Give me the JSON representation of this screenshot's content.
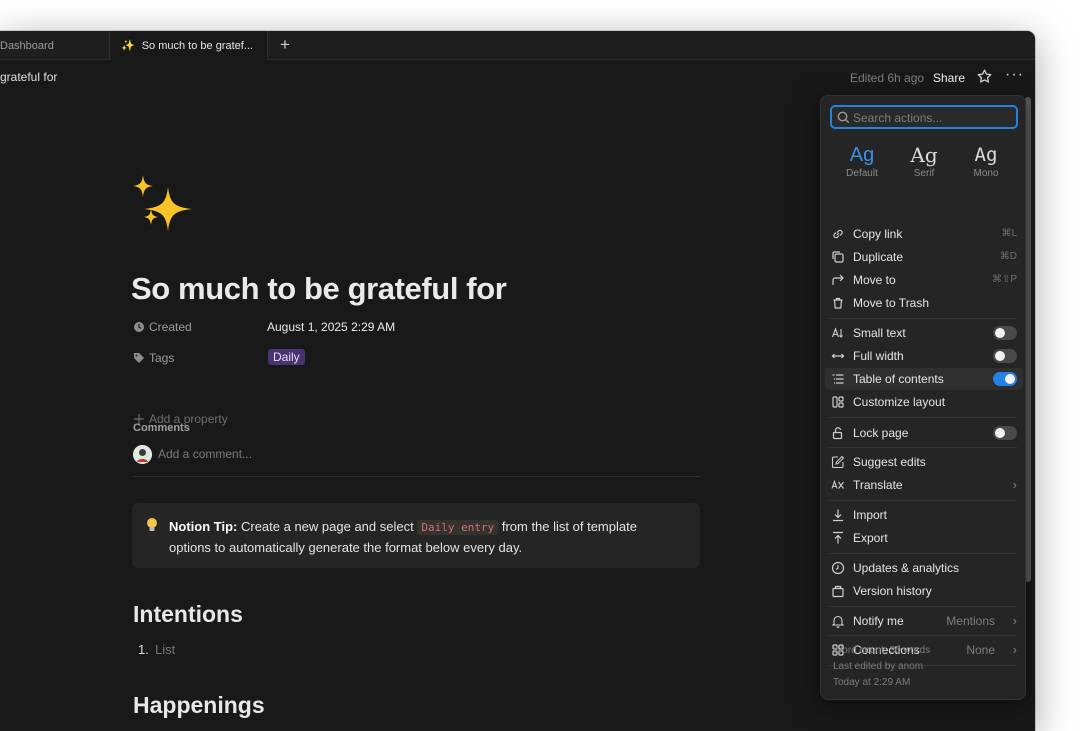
{
  "tabs": [
    {
      "label": "Dashboard"
    },
    {
      "emoji": "✨",
      "label": "So much to be gratef..."
    }
  ],
  "new_tab_icon": "plus-icon",
  "breadcrumb": "grateful for",
  "header": {
    "edited": "Edited 6h ago",
    "share": "Share",
    "favorite_icon": "star-icon",
    "more_icon": "more-icon"
  },
  "page": {
    "emoji_icon": "sparkles-icon",
    "title": "So much to be grateful for",
    "properties": {
      "created_label": "Created",
      "created_value": "August 1, 2025 2:29 AM",
      "tags_label": "Tags",
      "tag_value": "Daily",
      "add_property": "Add a property"
    },
    "comments_label": "Comments",
    "comment_placeholder": "Add a comment...",
    "callout": {
      "bold": "Notion Tip:",
      "text_before": "Create a new page and select",
      "code": "Daily entry",
      "text_after": "from the list of template options to automatically generate the format below every day."
    },
    "heading_intentions": "Intentions",
    "list_number": "1.",
    "list_placeholder": "List",
    "heading_happenings": "Happenings"
  },
  "menu": {
    "search_placeholder": "Search actions...",
    "fonts": [
      {
        "sample": "Ag",
        "label": "Default",
        "active": true
      },
      {
        "sample": "Ag",
        "label": "Serif",
        "active": false
      },
      {
        "sample": "Ag",
        "label": "Mono",
        "active": false
      }
    ],
    "items": {
      "copy_link": {
        "label": "Copy link",
        "shortcut": "⌘L"
      },
      "duplicate": {
        "label": "Duplicate",
        "shortcut": "⌘D"
      },
      "move_to": {
        "label": "Move to",
        "shortcut": "⌘⇧P"
      },
      "move_to_trash": {
        "label": "Move to Trash"
      },
      "small_text": {
        "label": "Small text",
        "on": false
      },
      "full_width": {
        "label": "Full width",
        "on": false
      },
      "table_of_contents": {
        "label": "Table of contents",
        "on": true
      },
      "customize_layout": {
        "label": "Customize layout"
      },
      "lock_page": {
        "label": "Lock page",
        "on": false
      },
      "suggest_edits": {
        "label": "Suggest edits"
      },
      "translate": {
        "label": "Translate"
      },
      "import": {
        "label": "Import"
      },
      "export": {
        "label": "Export"
      },
      "updates_analytics": {
        "label": "Updates & analytics"
      },
      "version_history": {
        "label": "Version history"
      },
      "notify_me": {
        "label": "Notify me",
        "value": "Mentions"
      },
      "connections": {
        "label": "Connections",
        "value": "None"
      }
    },
    "footer": {
      "word_count": "Word count: 30 words",
      "last_edited": "Last edited by anom",
      "time": "Today at 2:29 AM"
    }
  },
  "colors": {
    "background": "#191919",
    "accent": "#2383e2",
    "tag_bg": "#4a3470",
    "code_text": "#e06c6c"
  }
}
